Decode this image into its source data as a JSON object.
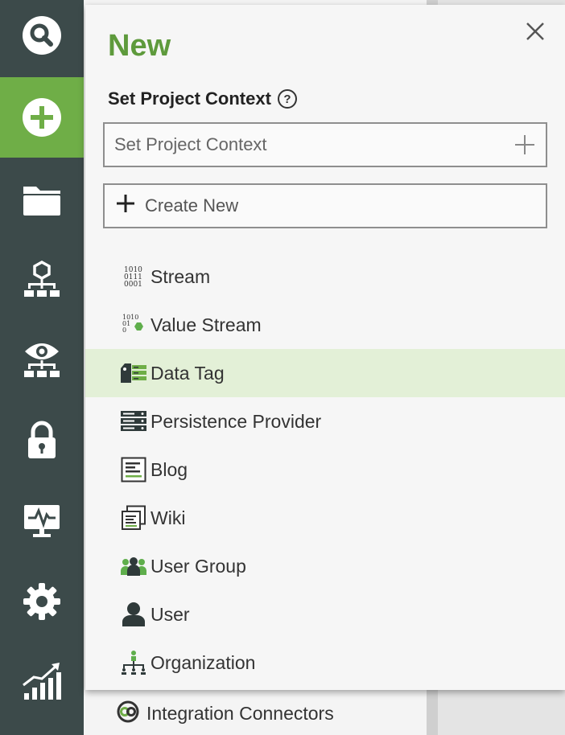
{
  "panel": {
    "title": "New",
    "context_label": "Set Project Context",
    "help_glyph": "?",
    "context_placeholder": "Set Project Context",
    "create_new_label": "Create New",
    "items": [
      {
        "label": "Stream",
        "icon": "stream-binary-icon"
      },
      {
        "label": "Value Stream",
        "icon": "value-stream-icon"
      },
      {
        "label": "Data Tag",
        "icon": "data-tag-icon",
        "highlighted": true
      },
      {
        "label": "Persistence Provider",
        "icon": "server-rack-icon"
      },
      {
        "label": "Blog",
        "icon": "blog-document-icon"
      },
      {
        "label": "Wiki",
        "icon": "wiki-pages-icon"
      },
      {
        "label": "User Group",
        "icon": "user-group-icon"
      },
      {
        "label": "User",
        "icon": "user-icon"
      },
      {
        "label": "Organization",
        "icon": "organization-icon"
      }
    ]
  },
  "sidebar": {
    "items": [
      {
        "name": "search",
        "icon": "search-icon"
      },
      {
        "name": "new",
        "icon": "plus-circle-icon",
        "active": true
      },
      {
        "name": "projects",
        "icon": "folder-icon"
      },
      {
        "name": "hierarchy",
        "icon": "hexagon-tree-icon"
      },
      {
        "name": "observe",
        "icon": "eye-tree-icon"
      },
      {
        "name": "security",
        "icon": "lock-icon"
      },
      {
        "name": "monitor",
        "icon": "monitor-pulse-icon"
      },
      {
        "name": "settings",
        "icon": "gear-icon"
      },
      {
        "name": "analytics",
        "icon": "chart-trend-icon"
      }
    ]
  },
  "background": {
    "row_label": "Integration Connectors",
    "row_icon": "integration-connector-icon"
  },
  "colors": {
    "sidebar_bg": "#3c4a4a",
    "active_green": "#6fae47",
    "title_green": "#5e9a3c",
    "highlight_bg": "#e3f0d7"
  }
}
